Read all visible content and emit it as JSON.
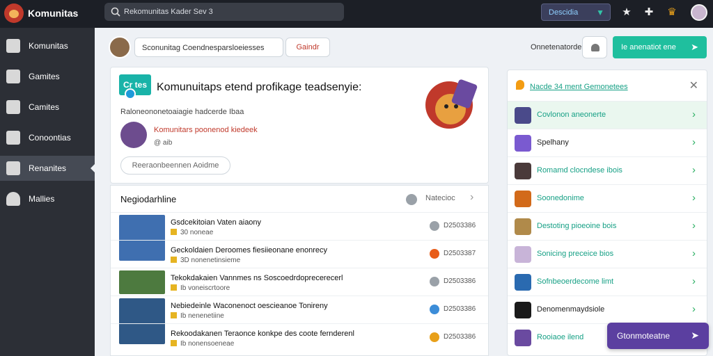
{
  "app": {
    "name": "Komunitas"
  },
  "search": {
    "text": "Rekomunitas Kader Sev 3"
  },
  "header": {
    "desc_button": "Descidia",
    "icons": [
      "star-icon",
      "puzzle-icon",
      "trophy-icon",
      "user-avatar"
    ]
  },
  "sidebar": {
    "items": [
      {
        "label": "Komunitas",
        "icon": "home-icon"
      },
      {
        "label": "Gamites",
        "icon": "gamepad-icon"
      },
      {
        "label": "Camites",
        "icon": "box-icon"
      },
      {
        "label": "Conoontias",
        "icon": "monitor-icon"
      },
      {
        "label": "Renanites",
        "icon": "home-icon",
        "active": true
      },
      {
        "label": "Mallies",
        "icon": "users-icon"
      }
    ]
  },
  "subheader": {
    "input_text": "Sconunitag  Coendnesparsloeiesses",
    "button_label": "Gaindr",
    "right_label": "Onnetenatorde",
    "green_button": "Ie anenatiot ene"
  },
  "feature": {
    "badge": "Cr  tes",
    "title": "Komunuitaps etend profikage teadsenyie:",
    "subtitle": "Raloneononetoaiagie hadcerde Ibaa",
    "author_name": "Komunitars poonenod kiedeek",
    "author_meta": "@ aib",
    "button": "Reeraonbeennen Aoidme"
  },
  "list": {
    "title": "Negiodarhline",
    "right_label": "Natecioc",
    "rows": [
      {
        "title": "Gsdcekitoian  Vaten aiaony",
        "meta": "30 noneae",
        "num": "D2503386",
        "thumb": "#3f6fb0",
        "ic": "#9aa1a8"
      },
      {
        "title": "Geckoldaien  Deroomes fiesiieonane enonrecy",
        "meta": "3D nonenetinsieme",
        "num": "D2503387",
        "thumb": "#3a5f9a",
        "ic": "#e85d1a"
      },
      {
        "title": "Tekokdakaien  Vannmes ns Soscoedrdoprecerecerl",
        "meta": "Ib voneiscrtoore",
        "num": "D2503386",
        "thumb": "#4d7a3f",
        "ic": "#9aa1a8"
      },
      {
        "title": "Nebiedeinle  Waconenoct oescieanoe Tonireny",
        "meta": "Ib nenenetiine",
        "num": "D2503386",
        "thumb": "#2f5886",
        "ic": "#3c8dd8"
      },
      {
        "title": "Rekoodakanen  Teraonce konkpe des coote fernderenl",
        "meta": "Ib nonensoeneae",
        "num": "D2503386",
        "thumb": "#7a5a3a",
        "ic": "#e8a01a"
      }
    ]
  },
  "panel": {
    "title": "Nacde 34 ment Gemonetees",
    "items": [
      {
        "label": "Covlonon aneonerte",
        "icon": "#4a4a8a",
        "highlight": true,
        "dark": false
      },
      {
        "label": "Spelhany",
        "icon": "#7a5ad0",
        "highlight": false,
        "dark": true
      },
      {
        "label": "Romamd clocndese ibois",
        "icon": "#4a3a3a",
        "highlight": false,
        "dark": false
      },
      {
        "label": "Soonedonime",
        "icon": "#d26a1a",
        "highlight": false,
        "dark": false
      },
      {
        "label": "Destoting  pioeoine bois",
        "icon": "#b08a4a",
        "highlight": false,
        "dark": false
      },
      {
        "label": "Sonicing  preceice bios",
        "icon": "#c8b4d8",
        "highlight": false,
        "dark": false
      },
      {
        "label": "Sofnbeoerdecome limt",
        "icon": "#2a6ab0",
        "highlight": false,
        "dark": false
      },
      {
        "label": "Denomenmaydsiole",
        "icon": "#1a1a1a",
        "highlight": false,
        "dark": true
      },
      {
        "label": "Rooiaoe ilend",
        "icon": "#6a4aa0",
        "highlight": false,
        "dark": false
      }
    ]
  },
  "float_button": "Gtonmoteatne"
}
